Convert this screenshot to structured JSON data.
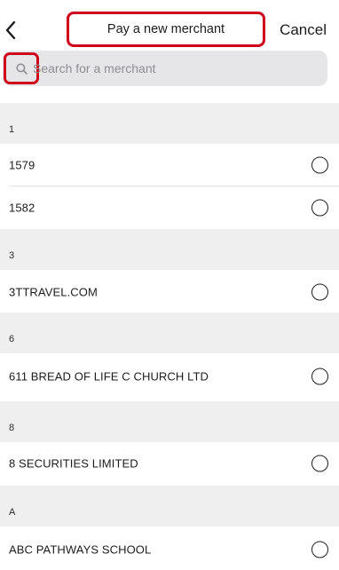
{
  "header": {
    "title": "Pay a new merchant",
    "cancel_label": "Cancel",
    "back_icon": "chevron-left-icon"
  },
  "search": {
    "placeholder": "Search for a merchant",
    "value": "",
    "icon": "search-icon"
  },
  "colors": {
    "highlight_outline": "#d0021b",
    "section_background": "#efefef",
    "search_background": "#e6e6e8"
  },
  "sections": [
    {
      "header": "1",
      "items": [
        "1579",
        "1582"
      ]
    },
    {
      "header": "3",
      "items": [
        "3TTRAVEL.COM"
      ]
    },
    {
      "header": "6",
      "items": [
        "611 BREAD OF LIFE C CHURCH LTD"
      ]
    },
    {
      "header": "8",
      "items": [
        "8 SECURITIES LIMITED"
      ]
    },
    {
      "header": "A",
      "items": [
        "ABC PATHWAYS SCHOOL"
      ]
    }
  ]
}
